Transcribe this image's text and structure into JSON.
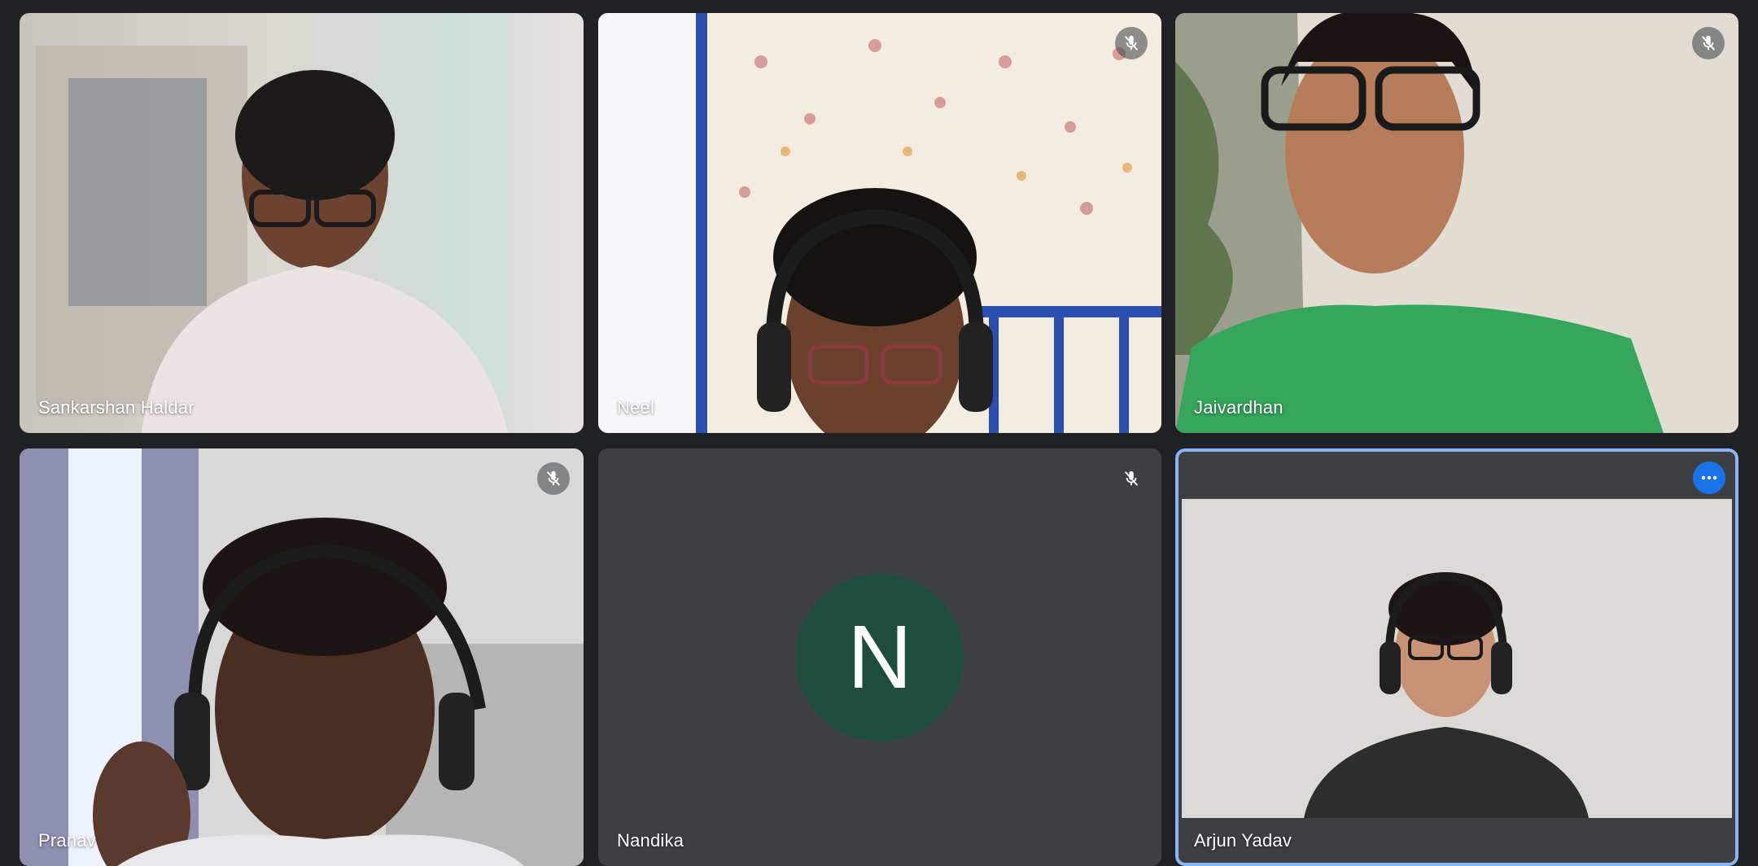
{
  "participants": [
    {
      "name": "Sankarshan Haldar",
      "muted": false,
      "camera_on": true
    },
    {
      "name": "Neel",
      "muted": true,
      "camera_on": true
    },
    {
      "name": "Jaivardhan",
      "muted": true,
      "camera_on": true
    },
    {
      "name": "Pranav",
      "muted": true,
      "camera_on": true
    },
    {
      "name": "Nandika",
      "muted": true,
      "camera_on": false,
      "initial": "N",
      "avatar_color": "#1e4d3e"
    },
    {
      "name": "Arjun Yadav",
      "muted": false,
      "camera_on": true,
      "active": true
    }
  ],
  "icons": {
    "mute": "mic-off-icon",
    "more": "more-options-icon"
  },
  "colors": {
    "background": "#202124",
    "tile": "#3c4043",
    "active_border": "#8ab4f8",
    "accent": "#1a73e8"
  }
}
